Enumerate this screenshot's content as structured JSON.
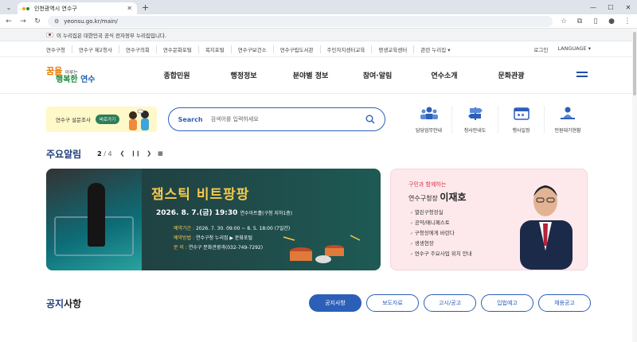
{
  "browser": {
    "tab_title": "인천광역시 연수구",
    "url": "yeonsu.go.kr/main/"
  },
  "gov_banner": {
    "text": "이 누리집은 대한민국 공식 전자정부 누리집입니다."
  },
  "util_links": [
    "연수구청",
    "연수구 제2청사",
    "연수구의회",
    "연수문화포털",
    "복지포털",
    "연수구보건소",
    "연수구립도서관",
    "주민자치센터교육",
    "평생교육센터",
    "관련 누리집 ▾"
  ],
  "util_right": {
    "login": "로그인",
    "language": "LANGUAGE ▾"
  },
  "logo": {
    "l1_a": "꿈을",
    "l1_b": "이루는",
    "l2_a": "행복한",
    "l2_b": "연수"
  },
  "menus": [
    "종합민원",
    "행정정보",
    "분야별 정보",
    "참여·알림",
    "연수소개",
    "문화관광"
  ],
  "survey": {
    "label": "연수구 설문조사",
    "button": "바로가기"
  },
  "search": {
    "label": "Search",
    "placeholder": "검색어를 입력하세요"
  },
  "quick": [
    {
      "label": "담당업무안내",
      "icon": "staff-icon"
    },
    {
      "label": "청사안내도",
      "icon": "signpost-icon"
    },
    {
      "label": "행사일정",
      "icon": "calendar-icon"
    },
    {
      "label": "민원대기현황",
      "icon": "service-counter-icon"
    }
  ],
  "notice": {
    "title": "주요알림",
    "current": "2",
    "total": "/ 4"
  },
  "banner": {
    "title": "잼스틱 비트팡팡",
    "date": "2026. 8. 7.(금) 19:30",
    "venue": "연수아트홀(구청 지하1층)",
    "rows": [
      {
        "k": "예약기간 :",
        "v": "2026. 7. 30. 09:00 ~ 8. 5. 18:00 (7일간)"
      },
      {
        "k": "예약방법 :",
        "v": "연수구청 누리집 ▶ 문화포털"
      },
      {
        "k": "문      의 :",
        "v": "연수구 문화관광과(032-749-7292)"
      }
    ]
  },
  "mayor": {
    "sub": "구민과 함께하는",
    "role": "연수구청장",
    "name": "이재호",
    "items": [
      "열린구청장실",
      "공약/매니페스토",
      "구청장에게 바란다",
      "생생현장",
      "연수구 주요사업 위치 안내"
    ]
  },
  "notices2": {
    "title_a": "공지",
    "title_b": "사항",
    "tabs": [
      "공지사항",
      "보도자료",
      "고시/공고",
      "입법예고",
      "채용공고"
    ]
  }
}
